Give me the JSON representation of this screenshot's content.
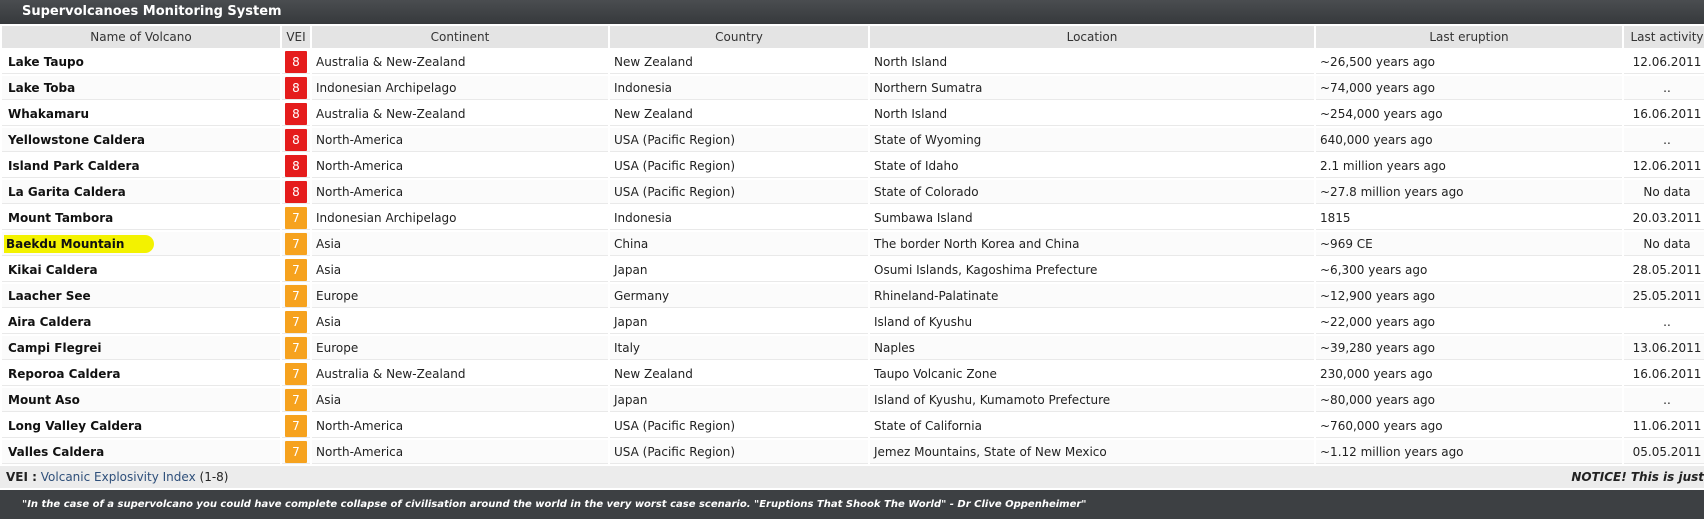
{
  "title": "Supervolcanoes Monitoring System",
  "columns": [
    "Name of Volcano",
    "VEI",
    "Continent",
    "Country",
    "Location",
    "Last eruption",
    "Last activity"
  ],
  "rows": [
    {
      "name": "Lake Taupo",
      "vei": "8",
      "continent": "Australia & New-Zealand",
      "country": "New Zealand",
      "location": "North Island",
      "last_eruption": "~26,500 years ago",
      "last_activity": "12.06.2011"
    },
    {
      "name": "Lake Toba",
      "vei": "8",
      "continent": "Indonesian Archipelago",
      "country": "Indonesia",
      "location": "Northern Sumatra",
      "last_eruption": "~74,000 years ago",
      "last_activity": ".."
    },
    {
      "name": "Whakamaru",
      "vei": "8",
      "continent": "Australia & New-Zealand",
      "country": "New Zealand",
      "location": "North Island",
      "last_eruption": "~254,000 years ago",
      "last_activity": "16.06.2011"
    },
    {
      "name": "Yellowstone Caldera",
      "vei": "8",
      "continent": "North-America",
      "country": "USA (Pacific Region)",
      "location": "State of Wyoming",
      "last_eruption": "640,000 years ago",
      "last_activity": ".."
    },
    {
      "name": "Island Park Caldera",
      "vei": "8",
      "continent": "North-America",
      "country": "USA (Pacific Region)",
      "location": "State of Idaho",
      "last_eruption": "2.1 million years ago",
      "last_activity": "12.06.2011"
    },
    {
      "name": "La Garita Caldera",
      "vei": "8",
      "continent": "North-America",
      "country": "USA (Pacific Region)",
      "location": "State of Colorado",
      "last_eruption": "~27.8 million years ago",
      "last_activity": "No data"
    },
    {
      "name": "Mount Tambora",
      "vei": "7",
      "continent": "Indonesian Archipelago",
      "country": "Indonesia",
      "location": "Sumbawa Island",
      "last_eruption": "1815",
      "last_activity": "20.03.2011"
    },
    {
      "name": "Baekdu Mountain",
      "vei": "7",
      "continent": "Asia",
      "country": "China",
      "location": "The border North Korea and China",
      "last_eruption": "~969 CE",
      "last_activity": "No data"
    },
    {
      "name": "Kikai Caldera",
      "vei": "7",
      "continent": "Asia",
      "country": "Japan",
      "location": "Osumi Islands, Kagoshima Prefecture",
      "last_eruption": "~6,300 years ago",
      "last_activity": "28.05.2011"
    },
    {
      "name": "Laacher See",
      "vei": "7",
      "continent": "Europe",
      "country": "Germany",
      "location": "Rhineland-Palatinate",
      "last_eruption": "~12,900 years ago",
      "last_activity": "25.05.2011"
    },
    {
      "name": "Aira Caldera",
      "vei": "7",
      "continent": "Asia",
      "country": "Japan",
      "location": "Island of Kyushu",
      "last_eruption": "~22,000 years ago",
      "last_activity": ".."
    },
    {
      "name": "Campi Flegrei",
      "vei": "7",
      "continent": "Europe",
      "country": "Italy",
      "location": "Naples",
      "last_eruption": "~39,280 years ago",
      "last_activity": "13.06.2011"
    },
    {
      "name": "Reporoa Caldera",
      "vei": "7",
      "continent": "Australia & New-Zealand",
      "country": "New Zealand",
      "location": "Taupo Volcanic Zone",
      "last_eruption": "230,000 years ago",
      "last_activity": "16.06.2011"
    },
    {
      "name": "Mount Aso",
      "vei": "7",
      "continent": "Asia",
      "country": "Japan",
      "location": "Island of Kyushu, Kumamoto Prefecture",
      "last_eruption": "~80,000 years ago",
      "last_activity": ".."
    },
    {
      "name": "Long Valley Caldera",
      "vei": "7",
      "continent": "North-America",
      "country": "USA (Pacific Region)",
      "location": "State of California",
      "last_eruption": "~760,000 years ago",
      "last_activity": "11.06.2011"
    },
    {
      "name": "Valles Caldera",
      "vei": "7",
      "continent": "North-America",
      "country": "USA (Pacific Region)",
      "location": "Jemez Mountains, State of New Mexico",
      "last_eruption": "~1.12 million years ago",
      "last_activity": "05.05.2011"
    }
  ],
  "highlighted_row": "Baekdu Mountain",
  "footer": {
    "vei_label": "VEI :",
    "vei_link": "Volcanic Explosivity Index",
    "vei_range": "(1-8)",
    "notice": "NOTICE! This is just"
  },
  "quote": "\"In the case of a supervolcano you could have complete collapse of civilisation around the world in the very worst case scenario. \"Eruptions That Shook The World\" - Dr Clive Oppenheimer\"",
  "colors": {
    "vei8": "#e51c1c",
    "vei7": "#f6a21e",
    "highlight": "#f3f200",
    "header_bar": "#3d4043"
  }
}
